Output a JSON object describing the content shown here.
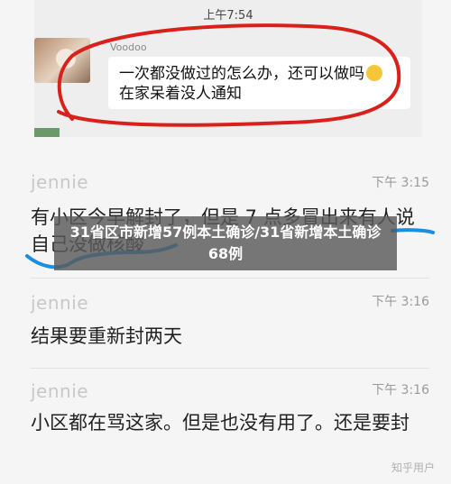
{
  "top_screenshot": {
    "time": "上午7:54",
    "sender": "Voodoo",
    "message": "一次都没做过的怎么办，还可以做吗",
    "message_line2": "在家呆着没人通知",
    "colors": {
      "circle": "#d9201a",
      "bubble": "#ffffff"
    }
  },
  "chat": [
    {
      "name": "jennie",
      "time": "下午 3:15",
      "text": "有小区今早解封了，但是 7 点多冒出来有人说自己没做核酸"
    },
    {
      "name": "jennie",
      "time": "下午 3:16",
      "text": "结果要重新封两天"
    },
    {
      "name": "jennie",
      "time": "下午 3:16",
      "text": "小区都在骂这家。但是也没有用了。还是要封"
    }
  ],
  "headline": "31省区市新增57例本土确诊/31省新增本土确诊68例",
  "watermark": "知乎用户",
  "colors": {
    "blue_mark": "#1a8fe0",
    "overlay": "#5a5a5a"
  }
}
